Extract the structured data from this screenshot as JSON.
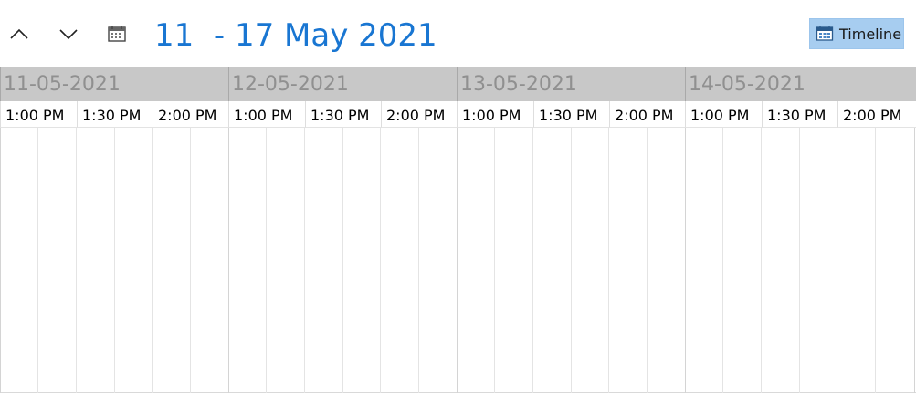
{
  "toolbar": {
    "prev_icon": "chevron-up-icon",
    "next_icon": "chevron-down-icon",
    "calendar_icon": "calendar-icon",
    "range_title": "11  - 17 May 2021",
    "view_button_label": "Timeline",
    "view_button_icon": "timeline-calendar-icon"
  },
  "colors": {
    "accent": "#1976d2",
    "view_button_bg": "#a7cdf0",
    "day_header_bg": "#c8c8c8",
    "day_header_text": "#909090"
  },
  "timeline": {
    "days": [
      {
        "date": "11-05-2021",
        "slots": [
          "1:00 PM",
          "1:30 PM",
          "2:00 PM"
        ]
      },
      {
        "date": "12-05-2021",
        "slots": [
          "1:00 PM",
          "1:30 PM",
          "2:00 PM"
        ]
      },
      {
        "date": "13-05-2021",
        "slots": [
          "1:00 PM",
          "1:30 PM",
          "2:00 PM"
        ]
      },
      {
        "date": "14-05-2021",
        "slots": [
          "1:00 PM",
          "1:30 PM",
          "2:00 PM"
        ]
      }
    ]
  }
}
